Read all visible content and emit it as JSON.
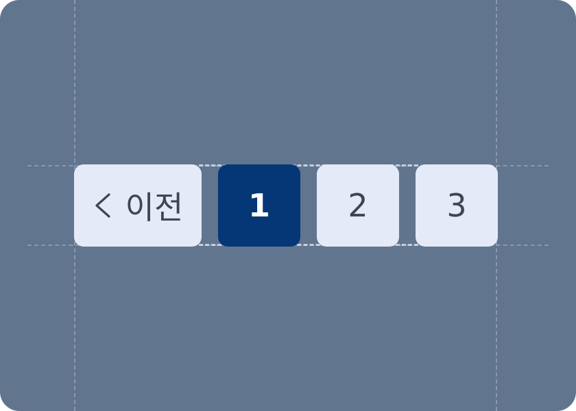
{
  "pagination": {
    "prev_label": "이전",
    "prev_icon": "chevron-left-icon",
    "pages": [
      {
        "label": "1",
        "active": true
      },
      {
        "label": "2",
        "active": false
      },
      {
        "label": "3",
        "active": false
      }
    ]
  },
  "colors": {
    "background": "#62758F",
    "button": "#E4EAF8",
    "active": "#053777",
    "text": "#3F4652",
    "active_text": "#FFFFFF"
  }
}
